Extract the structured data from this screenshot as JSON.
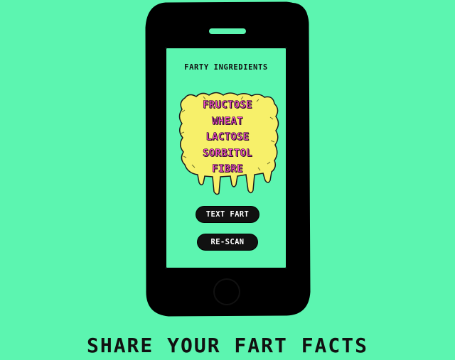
{
  "screen": {
    "title": "FARTY INGREDIENTS",
    "ingredients": [
      "FRUCTOSE",
      "WHEAT",
      "LACTOSE",
      "SORBITOL",
      "FIBRE"
    ]
  },
  "buttons": {
    "text_fart": "TEXT FART",
    "rescan": "RE-SCAN"
  },
  "tagline": "SHARE YOUR FART FACTS",
  "colors": {
    "background": "#5cf5b0",
    "phone": "#000000",
    "blob": "#f7f06a",
    "ingredient_text": "#ff4fd2",
    "button": "#111111",
    "button_text": "#ffffff"
  }
}
